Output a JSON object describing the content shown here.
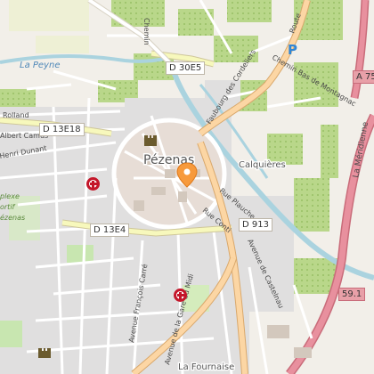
{
  "map": {
    "town_label": "Pézenas",
    "places": {
      "calquieres": "Calquières",
      "la_fournaise": "La Fournaise",
      "la_peyne": "La Peyne"
    },
    "roads": {
      "d30e5": "D 30E5",
      "d13e18": "D 13E18",
      "d13e4": "D 13E4",
      "d913": "D 913",
      "a75": "A 75",
      "km_59_1": "59.1",
      "faubourg": "Faubourg des Cordeliers",
      "route": "Route",
      "chemin_bas": "Chemin Bas de Montagnac",
      "la_meridienne": "La Méridienne",
      "rue_plauche": "Rue Plauche",
      "rue_conti": "Rue Conti",
      "avenue_castelnau": "Avenue de Castelnau",
      "avenue_gare_midi": "Avenue de la Gare du Midi",
      "avenue_carre": "Avenue François Carré",
      "chemin": "Chemin",
      "rolland": "Rolland",
      "camus": "Albert Camus",
      "dunant": "Henri Dunant",
      "complexe": "plexe",
      "sportif": "ortif",
      "pezenas_small": "ézenas"
    },
    "icons": {
      "pharmacy": "pharmacy-icon",
      "castle": "castle-icon",
      "parking": "parking-icon",
      "marker": "map-marker-icon"
    },
    "colors": {
      "background": "#f2efe9",
      "water": "#aad3df",
      "vineyard": "#acd07a",
      "residential": "#e0dfdf",
      "motorway": "#e8909e",
      "primary": "#fcd6a4",
      "secondary": "#f7f8bc",
      "marker": "#f79a3c",
      "pharmacy": "#c4162a"
    }
  }
}
